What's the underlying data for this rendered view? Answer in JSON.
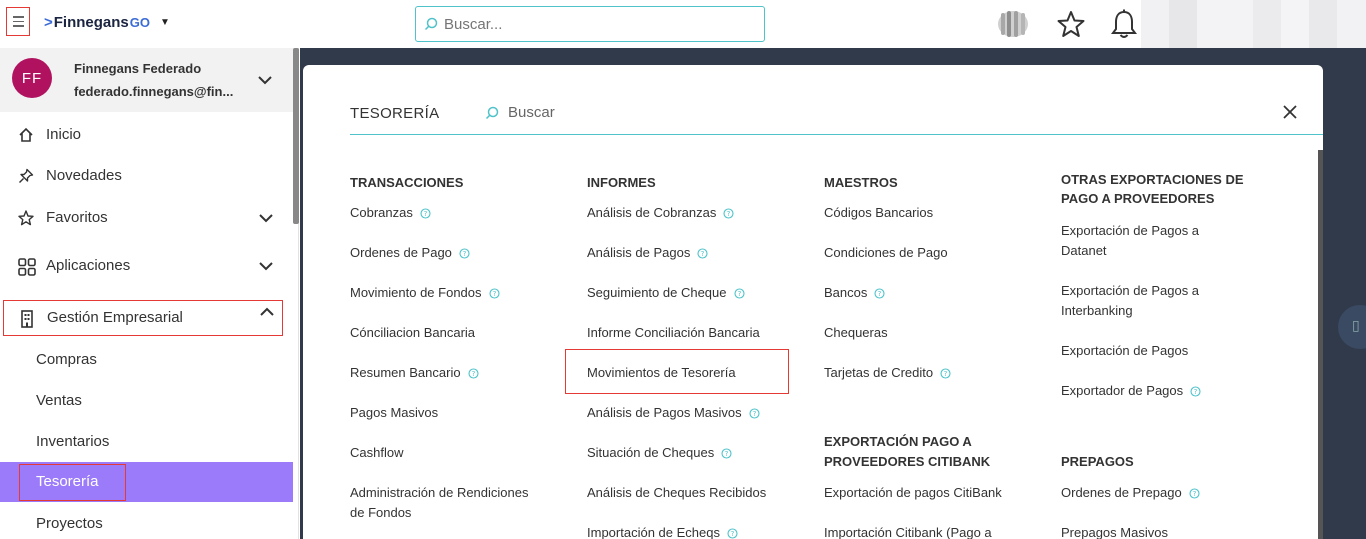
{
  "topbar": {
    "menu_icon": "hamburger-icon",
    "logo_text": "Finnegans",
    "logo_suffix": "GO",
    "search_placeholder": "Buscar...",
    "icons": [
      "finnegans-globe-icon",
      "star-icon",
      "bell-icon"
    ]
  },
  "user": {
    "initials": "FF",
    "name": "Finnegans Federado",
    "email": "federado.finnegans@fin..."
  },
  "sidebar": {
    "items": [
      {
        "label": "Inicio",
        "icon": "home-icon"
      },
      {
        "label": "Novedades",
        "icon": "pin-icon"
      },
      {
        "label": "Favoritos",
        "icon": "star-icon"
      },
      {
        "label": "Aplicaciones",
        "icon": "grid-icon"
      },
      {
        "label": "Gestión Empresarial",
        "icon": "building-icon"
      }
    ],
    "sub_items": [
      "Compras",
      "Ventas",
      "Inventarios",
      "Tesorería",
      "Proyectos"
    ],
    "active_sub": "Tesorería"
  },
  "panel": {
    "title": "TESORERÍA",
    "search_placeholder": "Buscar",
    "columns": [
      {
        "heading": "TRANSACCIONES",
        "links": [
          {
            "label": "Cobranzas",
            "help": true
          },
          {
            "label": "Ordenes de Pago",
            "help": true
          },
          {
            "label": "Movimiento de Fondos",
            "help": true
          },
          {
            "label": "Cónciliacion Bancaria",
            "help": false
          },
          {
            "label": "Resumen Bancario",
            "help": true
          },
          {
            "label": "Pagos Masivos",
            "help": false
          },
          {
            "label": "Cashflow",
            "help": false
          },
          {
            "label": "Administración de Rendiciones",
            "label2": "de Fondos",
            "help": false
          }
        ]
      },
      {
        "heading": "INFORMES",
        "links": [
          {
            "label": "Análisis de Cobranzas",
            "help": true
          },
          {
            "label": "Análisis de Pagos",
            "help": true
          },
          {
            "label": "Seguimiento de Cheque",
            "help": true
          },
          {
            "label": "Informe Conciliación Bancaria",
            "help": false
          },
          {
            "label": "Movimientos de Tesorería",
            "help": false
          },
          {
            "label": "Análisis de Pagos Masivos",
            "help": true
          },
          {
            "label": "Situación de Cheques",
            "help": true
          },
          {
            "label": "Análisis de Cheques Recibidos",
            "help": false
          },
          {
            "label": "Importación de Echeqs",
            "help": true
          }
        ]
      },
      {
        "heading": "MAESTROS",
        "links": [
          {
            "label": "Códigos Bancarios",
            "help": false
          },
          {
            "label": "Condiciones de Pago",
            "help": false
          },
          {
            "label": "Bancos",
            "help": true
          },
          {
            "label": "Chequeras",
            "help": false
          },
          {
            "label": "Tarjetas de Credito",
            "help": true
          }
        ],
        "heading2_line1": "EXPORTACIÓN PAGO A",
        "heading2_line2": "PROVEEDORES CITIBANK",
        "links2": [
          {
            "label": "Exportación de pagos CitiBank",
            "help": false
          },
          {
            "label": "Importación Citibank (Pago a",
            "help": false
          }
        ]
      },
      {
        "heading_line1": "OTRAS EXPORTACIONES DE",
        "heading_line2": "PAGO A PROVEEDORES",
        "links": [
          {
            "label": "Exportación de Pagos a",
            "label2": "Datanet",
            "help": false
          },
          {
            "label": "Exportación de Pagos a",
            "label2": "Interbanking",
            "help": false
          },
          {
            "label": "Exportación de Pagos",
            "help": false
          },
          {
            "label": "Exportador de Pagos",
            "help": true
          }
        ],
        "heading2": "PREPAGOS",
        "links2": [
          {
            "label": "Ordenes de Prepago",
            "help": true
          },
          {
            "label": "Prepagos Masivos",
            "help": false
          }
        ]
      }
    ]
  },
  "colors": {
    "accent_teal": "#4fc3c9",
    "active_purple": "#9b7bfa",
    "dark_bg": "#313a4b",
    "avatar": "#b0125f",
    "highlight_red": "#e53935"
  }
}
